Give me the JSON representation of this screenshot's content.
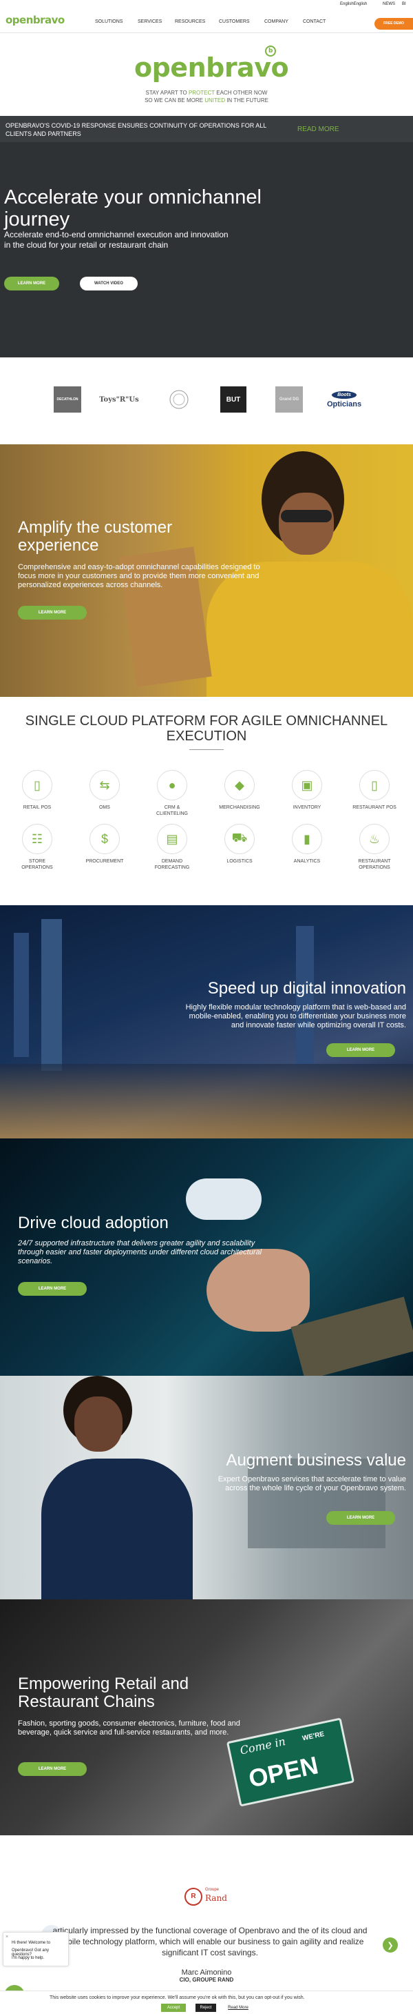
{
  "topbar": {
    "language": "English",
    "language_selected": "English",
    "news": "NEWS",
    "extra": "BI"
  },
  "nav": {
    "logo": "openbravo",
    "items": [
      "SOLUTIONS",
      "SERVICES",
      "RESOURCES",
      "CUSTOMERS",
      "COMPANY",
      "CONTACT"
    ],
    "cta": "FREE DEMO"
  },
  "covid_banner": {
    "logo": "openbravo",
    "logo_mark": "b",
    "line1_pre": "STAY APART TO ",
    "line1_hl": "PROTECT",
    "line1_post": " EACH OTHER NOW",
    "line2_pre": "SO WE CAN BE MORE ",
    "line2_hl": "UNITED",
    "line2_post": " IN THE FUTURE"
  },
  "hero": {
    "notice": "OPENBRAVO'S COVID-19 RESPONSE ENSURES CONTINUITY OF OPERATIONS FOR ALL CLIENTS AND PARTNERS",
    "read_more": "READ MORE",
    "title": "Accelerate your omnichannel journey",
    "subtitle": "Accelerate end-to-end omnichannel execution and innovation in the cloud for your retail or restaurant chain",
    "learn_more": "LEARN MORE",
    "watch_video": "WATCH VIDEO"
  },
  "brands": [
    "DECATHLON",
    "Toys\"R\"Us",
    "",
    "BUT",
    "Grand DG",
    "Opticians"
  ],
  "brand_extra": "Boots",
  "amplify": {
    "title": "Amplify the customer experience",
    "desc": "Comprehensive and easy-to-adopt omnichannel capabilities designed to focus more in your customers and to provide them more convenient and personalized experiences across channels.",
    "cta": "LEARN MORE"
  },
  "platform": {
    "title": "SINGLE CLOUD PLATFORM FOR AGILE OMNICHANNEL EXECUTION",
    "tiles": [
      {
        "label": "RETAIL POS",
        "icon": "mobile-icon"
      },
      {
        "label": "OMS",
        "icon": "shuffle-icon"
      },
      {
        "label": "CRM & CLIENTELING",
        "icon": "person-icon"
      },
      {
        "label": "MERCHANDISING",
        "icon": "tag-icon"
      },
      {
        "label": "INVENTORY",
        "icon": "box-icon"
      },
      {
        "label": "RESTAURANT POS",
        "icon": "mobile-icon"
      },
      {
        "label": "STORE OPERATIONS",
        "icon": "sitemap-icon"
      },
      {
        "label": "PROCUREMENT",
        "icon": "dollar-icon"
      },
      {
        "label": "DEMAND FORECASTING",
        "icon": "chart-icon"
      },
      {
        "label": "LOGISTICS",
        "icon": "truck-icon"
      },
      {
        "label": "ANALYTICS",
        "icon": "bar-chart-icon"
      },
      {
        "label": "RESTAURANT OPERATIONS",
        "icon": "cutlery-icon"
      }
    ]
  },
  "innovation": {
    "title": "Speed up digital innovation",
    "desc": "Highly flexible modular technology platform that is web-based and mobile-enabled, enabling you to differentiate your business more and innovate faster while optimizing overall IT costs.",
    "cta": "LEARN MORE"
  },
  "cloud": {
    "title": "Drive cloud adoption",
    "desc": "24/7 supported infrastructure that delivers greater agility and scalability through easier and faster deployments under different cloud architectural scenarios.",
    "cta": "LEARN MORE"
  },
  "value": {
    "title": "Augment business value",
    "desc": "Expert Openbravo services that accelerate time to value across the whole life cycle of your Openbravo system.",
    "cta": "LEARN MORE"
  },
  "retail": {
    "title": "Empowering Retail and Restaurant Chains",
    "desc": "Fashion, sporting goods, consumer electronics, furniture, food and beverage, quick service and full-service restaurants, and more.",
    "cta": "LEARN MORE",
    "sign_top": "Come in",
    "sign_small": "WE'RE",
    "sign_main": "OPEN"
  },
  "testimonial": {
    "brand_small": "Groupe",
    "brand": "Rand",
    "quote": "articularly impressed by the functional coverage of Openbravo and the of its cloud and mobile technology platform, which will enable our business to gain agility and realize significant IT cost savings.",
    "name": "Marc Aimonino",
    "role": "CIO, GROUPE RAND"
  },
  "chat": {
    "greeting": "Hi there! Welcome to",
    "line2": "Openbravo! Got any questions?",
    "line3": "I'm happy to help."
  },
  "cookie": {
    "message": "This website uses cookies to improve your experience. We'll assume you're ok with this, but you can opt-out if you wish.",
    "accept": "Accept",
    "reject": "Reject",
    "read_more": "Read More"
  },
  "colors": {
    "brand_green": "#7cb342",
    "cta_orange": "#f07f1f",
    "dark": "#2f3234"
  }
}
